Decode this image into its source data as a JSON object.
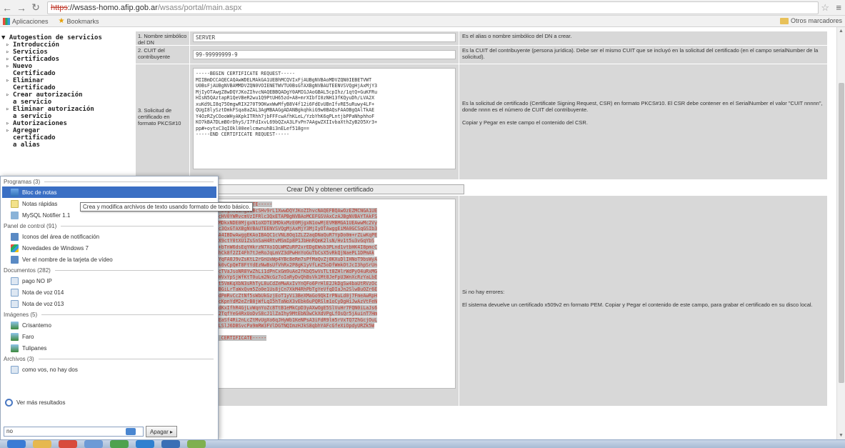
{
  "browser": {
    "url": {
      "scheme": "https",
      "separator": "://",
      "host": "wsass-homo.afip.gob.ar",
      "path": "/wsass/portal/main.aspx"
    },
    "bookmarks": [
      {
        "label": "Aplicaciones"
      },
      {
        "label": "Bookmarks"
      }
    ],
    "other_bookmarks": "Otros marcadores"
  },
  "tree": {
    "root": "Autogestion de servicios",
    "items": [
      {
        "label": "Introducción"
      },
      {
        "label": "Servicios"
      },
      {
        "label": "Certificados"
      },
      {
        "label": "Nuevo\nCertificado"
      },
      {
        "label": "Eliminar\nCertificado"
      },
      {
        "label": "Crear autorización\na servicio"
      },
      {
        "label": "Eliminar autorización\na servicio"
      },
      {
        "label": "Autorizaciones"
      },
      {
        "label": "Agregar\ncertificado\na alias"
      }
    ]
  },
  "form": {
    "rows": [
      {
        "label": "1. Nombre simbólico del DN",
        "value": "SERVER",
        "description": "Es el alias o nombre simbólico del DN a crear."
      },
      {
        "label": "2. CUIT del contribuyente",
        "value": "99-99999999-9",
        "description": "Es la CUIT del contribuyente (persona jurídica). Debe ser el mismo CUIT que se incluyó en la solicitud del certificado (en el campo serialNumber de la solicitud)."
      },
      {
        "label": "3. Solicitud de certificado en formato PKCS#10",
        "value": "-----BEGIN CERTIFICATE REQUEST-----\nMIIBmDCCAQECAQAwWDELMAkGA1UEBhMCQVIxFjAUBgNVBAoMDVZQN0IEBETVWT\nU0BsFjAUBgNVBAMMDVZQN0VOIENETWVTU0BsGTAXBgNVBAUTEENVSVQgHjAxMjY3\nMjIyOTAwgZ8wDQYJKoZIhvcNAQEBBQADgY0AMIGJAoGBAL5cpIhz/1qtQ+GuKFRu\nHIsN5QAztapR1QeVBeR2wu1Q9PtUH65zd+A8+mrXIbfI0zNH13fKQyuDh/LVA2X\nxuKd9LI8q75OmgwRIX270T9OKwxWwMfyB8V4f12i6FdEvUBnIfvRE5uRuwy4LF+\nQUgI8lySztDmkFSqa8aZAL3AgMBAAGgADANBgkqhkiG9w0BAQsFAAOBgQAlTkAE\nY4OzRZyCOooWHyAKpkITRhh7jbFFFcwAfhKLeL/YzbYhK6qPLntjbPPaNhphhoF\nKO7kBA7DLmBOrDhyS/I7FdIxvL69bQZxA3LFvPn7AAgwZXIIvbaXthZyB2O5Xr3+\npp#+oytxC3qIOkl00eelcmwnuhBi3nELef518g==\n-----END CERTIFICATE REQUEST-----",
        "description": "Es la solicitud de certificado (Certificate Signing Request, CSR) en formato PKCS#10. El CSR debe contener en el SerialNumber el valor \"CUIT nnnnn\", donde nnnn es el número de CUIT del contribuyente.\n\nCopiar y Pegar en este campo el contenido del CSR."
      }
    ],
    "create_button": "Crear DN y obtener certificado",
    "certificate": {
      "value": "-----BEGIN CERTIFICATE-----\nMIIDRjCCAi6gAwIBAgIIBcSHv9rL1XwwDQYJKoZIhvcNAQEFBQAwOzEZMCNGA1UE\nAwwQQ29tcHV0YWRvcmVzIFRlc3QxETAPBgNVBAoMCEFGSVAxCzAJBgNVBAYTAkFS\nMB4XDTE1MDkxNDE0MjgxN1oXDTE3MDkxMzE0MjgxN1owMjEVMBMGA1UEAwwMc2Vy\ndmVyX3Rlc3QxGTAXBgNVBAUTEENVSVQgMjAxMjY3MjIyOTAwggEiMA0GCSqGSIb3\nDQEBAQUAA4IBDwAwggEKAoIBAQC1cVNL8Oq1ZLZ2aqDNaQuR7YpDo0m+rZLwKqPE\nfH8VaLR1X9ctY0tXU1ZsSnSaH4RtvMSmIp8P1JbHnRQmK2lsN/Hv1t5u3vGqYbS\nCh9P8vZy+bTnW6dsEqYHkrzN7Xo1QLWMZuRP2xrEDgEWsb3PLnd1vtbHK4I8pmcC\nVU3mX0AyhCk8f2ZI4Fh7tJeRoJqLmVZ3dPwHnYoGuTbCsX5vRkQjNaePL1DPmAk\nXo+H1KhlYqFA0J9vZsKtL2rGnUxWp4YBc8eRm7sPfMaQvZj0KXuDlIHNoT9bsWyA\nLjH6Ra4xk0vCpQmT8FtYdEzNwBsUfVhRx2P8gK1yVfLmZ5oDfWmkOtJcI3hpSrUn\nB7qyMXE4cTVaJsoNR8YwZhLi1dPnCxGm9uAe2fKbQ5wVsTLt8ZHlrWdPyO4uRxMG\n3nBCdaE6HVxYpSjWfKtT0uLm2NcGz7oIaRyDvQhBsVk1Mt8JeFpU3WnXcRzYaLbE\nfGoAGjP7t5VmKqXbN3sRhTyL8uCdZeMwAxIvYnQFo6PrHlE2JkDgSw4baUtRVzOc\nKdNp3yHfBGiLrTaWxQvm5Zo0e1Us8jCn7XkM4RhPbTgYeVfqDIaJn2SlwBuOZr6E\nhAqLxY8HdPmRvCcZtNf5sWbUkGzjEoT1yVi3BeXMaGo9QkIrPNuLd0j7FmeAwRpH\nUtGxVsO4cKpnYdM2eZrB8jWfLqI5hTaNoX3vEbk6uPQRSlm1oCyDgHiJwAzVtFeN\nMa9P2sUbdKxIfhR4GjLvWqnYoZc8TtB1eMkCpD3yAXwOgE5SlVuHr7FQN0iLaJs6\nPzBhWnKm2TqfYeG4RxUoDvS8cJ1lZaIhy9MtEbN3wCkXdVPgLfOsQr5jAuinT7Hm\n0DwYp8BkEaSf4Ri2nLcZtMvUgXo6qJHyWb1KeNPsA3iFdR9lm5rVxTQ7ZhGcjOuL\nKuyxcTBOLSlJ6DBSvcPa9mRW3FVlDGTNQImzHJkS8qbhYAFcGfeXiOpdyURZk5W\nNyV2ZNXF\n-----END CERTIFICATE-----",
      "description": "Si no hay errores:\n\nEl sistema devuelve un certificado x509v2 en formato PEM. Copiar y Pegar el contenido de este campo, para grabar el certificado en su disco local."
    }
  },
  "start_menu": {
    "groups": [
      {
        "title": "Programas (3)",
        "items": [
          {
            "label": "Bloc de notas",
            "icon": "notepad-icon"
          },
          {
            "label": "Notas rápidas",
            "icon": "sticky-notes-icon"
          },
          {
            "label": "MySQL Notifier 1.1",
            "icon": "mysql-icon"
          }
        ]
      },
      {
        "title": "Panel de control (91)",
        "items": [
          {
            "label": "Iconos del área de notificación",
            "icon": "control-panel-icon"
          },
          {
            "label": "Novedades de Windows 7",
            "icon": "windows-icon"
          },
          {
            "label": "Ver el nombre de la tarjeta de vídeo",
            "icon": "display-icon"
          }
        ]
      },
      {
        "title": "Documentos (282)",
        "items": [
          {
            "label": "pago NO IP",
            "icon": "document-icon"
          },
          {
            "label": "Nota de voz 014",
            "icon": "document-icon"
          },
          {
            "label": "Nota de voz 013",
            "icon": "document-icon"
          }
        ]
      },
      {
        "title": "Imágenes (5)",
        "items": [
          {
            "label": "Crisantemo",
            "icon": "image-icon"
          },
          {
            "label": "Faro",
            "icon": "image-icon"
          },
          {
            "label": "Tulipanes",
            "icon": "image-icon"
          }
        ]
      },
      {
        "title": "Archivos (3)",
        "items": [
          {
            "label": "como vos, no hay dos",
            "icon": "document-icon"
          }
        ]
      }
    ],
    "more_results": "Ver más resultados",
    "search_value": "no",
    "shutdown": "Apagar",
    "tooltip": "Crea y modifica archivos de texto usando formato de texto básico."
  }
}
